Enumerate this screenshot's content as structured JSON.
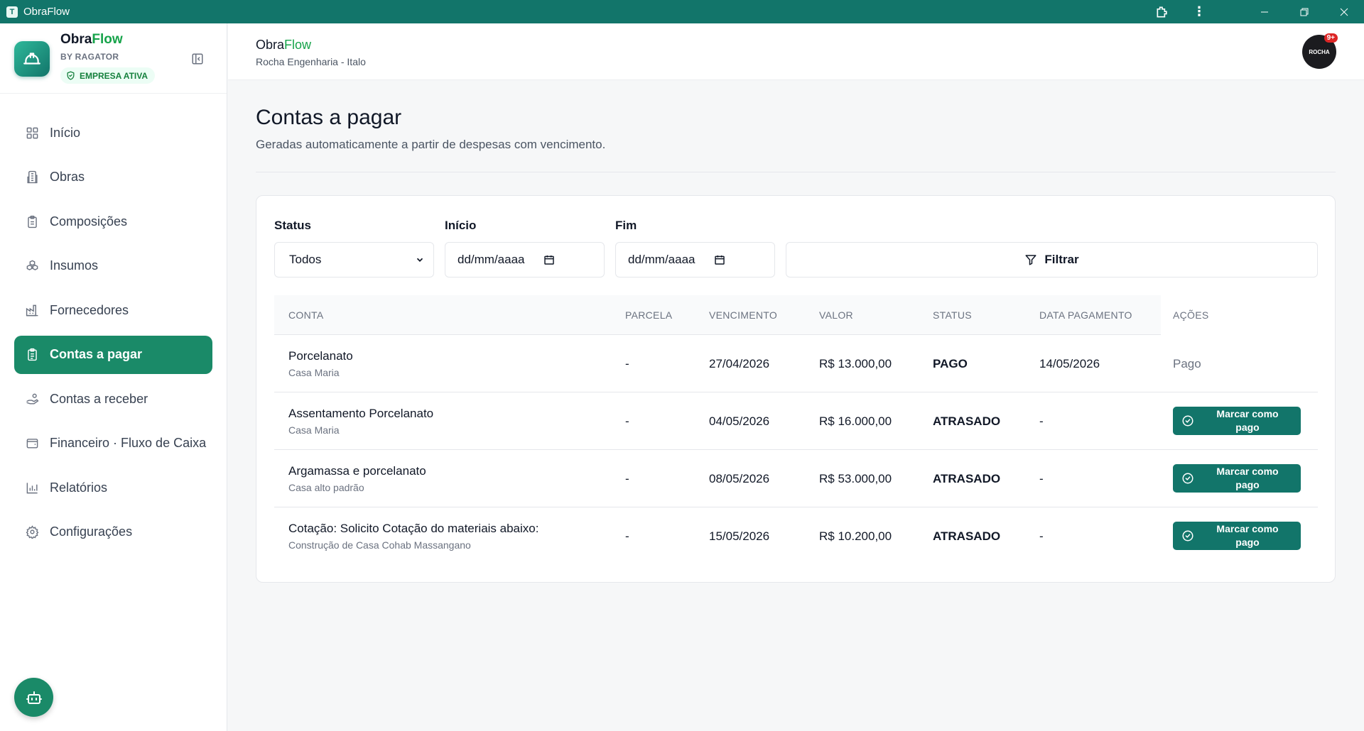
{
  "window": {
    "title": "ObraFlow"
  },
  "brand": {
    "name_main": "Obra",
    "name_accent": "Flow",
    "by": "BY RAGATOR",
    "badge": "EMPRESA ATIVA"
  },
  "nav": {
    "items": [
      {
        "label": "Início",
        "icon": "grid-icon",
        "active": false
      },
      {
        "label": "Obras",
        "icon": "building-icon",
        "active": false
      },
      {
        "label": "Composições",
        "icon": "clipboard-icon",
        "active": false
      },
      {
        "label": "Insumos",
        "icon": "boxes-icon",
        "active": false
      },
      {
        "label": "Fornecedores",
        "icon": "factory-icon",
        "active": false
      },
      {
        "label": "Contas a pagar",
        "icon": "clipboard-list-icon",
        "active": true
      },
      {
        "label": "Contas a receber",
        "icon": "hand-coins-icon",
        "active": false
      },
      {
        "label": "Financeiro · Fluxo de Caixa",
        "icon": "wallet-icon",
        "active": false
      },
      {
        "label": "Relatórios",
        "icon": "bar-chart-icon",
        "active": false
      },
      {
        "label": "Configurações",
        "icon": "gear-icon",
        "active": false
      }
    ]
  },
  "header": {
    "brand_main": "Obra",
    "brand_accent": "Flow",
    "company": "Rocha Engenharia - Italo",
    "avatar_text": "ROCHA",
    "avatar_badge": "9+"
  },
  "page": {
    "title": "Contas a pagar",
    "subtitle": "Geradas automaticamente a partir de despesas com vencimento."
  },
  "filters": {
    "status_label": "Status",
    "status_value": "Todos",
    "start_label": "Início",
    "start_placeholder": "dd/mm/aaaa",
    "end_label": "Fim",
    "end_placeholder": "dd/mm/aaaa",
    "filter_button": "Filtrar"
  },
  "table": {
    "headers": [
      "CONTA",
      "PARCELA",
      "VENCIMENTO",
      "VALOR",
      "STATUS",
      "DATA PAGAMENTO",
      "AÇÕES"
    ],
    "rows": [
      {
        "name": "Porcelanato",
        "project": "Casa Maria",
        "parcela": "-",
        "vencimento": "27/04/2026",
        "valor": "R$ 13.000,00",
        "status": "PAGO",
        "data_pagamento": "14/05/2026",
        "acao": "Pago"
      },
      {
        "name": "Assentamento Porcelanato",
        "project": "Casa Maria",
        "parcela": "-",
        "vencimento": "04/05/2026",
        "valor": "R$ 16.000,00",
        "status": "ATRASADO",
        "data_pagamento": "-",
        "acao": "Marcar como pago"
      },
      {
        "name": "Argamassa e porcelanato",
        "project": "Casa alto padrão",
        "parcela": "-",
        "vencimento": "08/05/2026",
        "valor": "R$ 53.000,00",
        "status": "ATRASADO",
        "data_pagamento": "-",
        "acao": "Marcar como pago"
      },
      {
        "name": "Cotação: Solicito Cotação do materiais abaixo:",
        "project": "Construção de Casa Cohab Massangano",
        "parcela": "-",
        "vencimento": "15/05/2026",
        "valor": "R$ 10.200,00",
        "status": "ATRASADO",
        "data_pagamento": "-",
        "acao": "Marcar como pago"
      }
    ]
  },
  "colors": {
    "primary": "#12756a",
    "accent": "#16a34a",
    "active_nav": "#1a8a68"
  }
}
